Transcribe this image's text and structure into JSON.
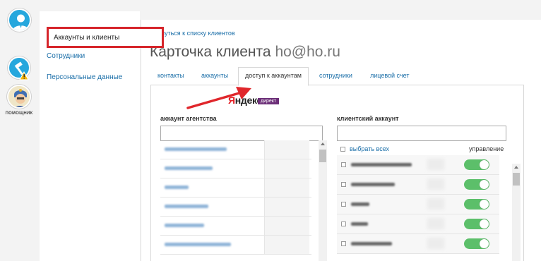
{
  "rail": {
    "helper_label": "ПОМОЩНИК",
    "icons": [
      "user-avatar-icon",
      "hammer-warning-icon",
      "helper-character-icon"
    ]
  },
  "menu": {
    "items": [
      {
        "label": "Аккаунты и клиенты",
        "active": true
      },
      {
        "label": "Сотрудники",
        "active": false
      },
      {
        "label": "Персональные данные",
        "active": false
      }
    ]
  },
  "main": {
    "back_link": "Вернуться к списку клиентов",
    "title": "Карточка клиента",
    "title_email": "ho@ho.ru",
    "tabs": [
      {
        "label": "контакты",
        "active": false
      },
      {
        "label": "аккаунты",
        "active": false
      },
      {
        "label": "доступ к аккаунтам",
        "active": true
      },
      {
        "label": "сотрудники",
        "active": false
      },
      {
        "label": "лицевой счет",
        "active": false
      }
    ]
  },
  "access": {
    "brand_first_letter": "Я",
    "brand_rest": "ндекс",
    "brand_badge": "директ",
    "agency_label": "аккаунт агентства",
    "client_label": "клиентский аккаунт",
    "select_all": "выбрать всех",
    "manage_label": "управление",
    "agency_accounts_blurred": 6,
    "client_accounts": [
      {
        "enabled": true
      },
      {
        "enabled": true
      },
      {
        "enabled": true
      },
      {
        "enabled": true
      },
      {
        "enabled": true
      }
    ]
  },
  "colors": {
    "accent_link": "#1a6ea8",
    "highlight_red": "#d6252b",
    "toggle_on": "#5cbf6a",
    "rail_blue": "#26a7dd",
    "direct_purple": "#6c2f78"
  }
}
